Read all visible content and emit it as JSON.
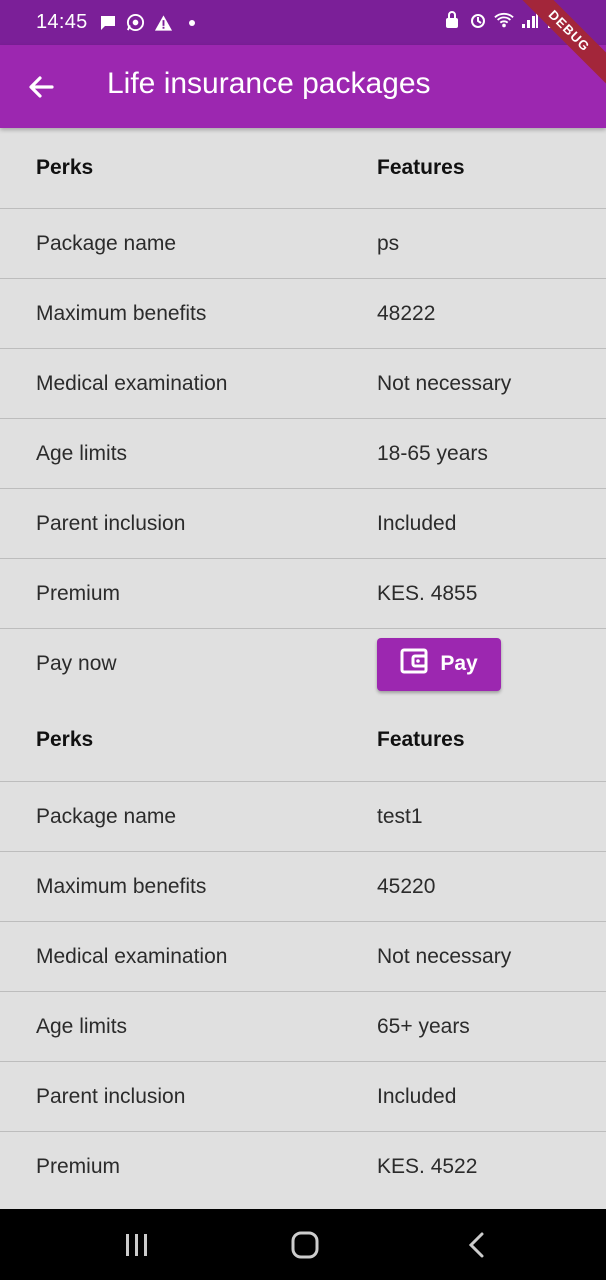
{
  "status_bar": {
    "time": "14:45",
    "background": "#7b1f98"
  },
  "app_bar": {
    "title": "Life insurance packages",
    "background": "#9c27b0",
    "back_icon": "arrow-back-icon"
  },
  "debug_banner": "DEBUG",
  "packages": [
    {
      "header": {
        "left": "Perks",
        "right": "Features"
      },
      "rows": [
        {
          "label": "Package name",
          "value": "ps"
        },
        {
          "label": "Maximum benefits",
          "value": "48222"
        },
        {
          "label": "Medical examination",
          "value": "Not necessary"
        },
        {
          "label": "Age limits",
          "value": "18-65 years"
        },
        {
          "label": "Parent inclusion",
          "value": "Included"
        },
        {
          "label": "Premium",
          "value": "KES. 4855"
        }
      ],
      "pay": {
        "label": "Pay now",
        "button_label": "Pay",
        "button_icon": "wallet-icon"
      }
    },
    {
      "header": {
        "left": "Perks",
        "right": "Features"
      },
      "rows": [
        {
          "label": "Package name",
          "value": "test1"
        },
        {
          "label": "Maximum benefits",
          "value": "45220"
        },
        {
          "label": "Medical examination",
          "value": "Not necessary"
        },
        {
          "label": "Age limits",
          "value": "65+ years"
        },
        {
          "label": "Parent inclusion",
          "value": "Included"
        },
        {
          "label": "Premium",
          "value": "KES. 4522"
        }
      ]
    }
  ],
  "nav_bar": {
    "icons": [
      "recent-apps-icon",
      "home-icon",
      "back-icon"
    ]
  }
}
